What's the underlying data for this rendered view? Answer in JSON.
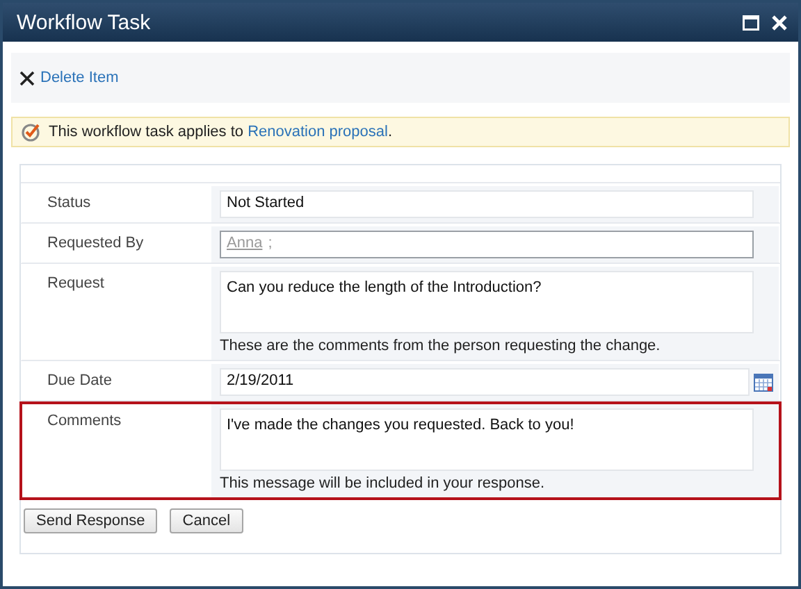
{
  "window": {
    "title": "Workflow Task"
  },
  "toolbar": {
    "delete_label": "Delete Item"
  },
  "info_bar": {
    "text": "This workflow task applies to ",
    "link": "Renovation proposal",
    "suffix": "."
  },
  "fields": [
    {
      "label": "Status",
      "kind": "text",
      "value": "Not Started",
      "highlighted": false
    },
    {
      "label": "Requested By",
      "kind": "people",
      "value": "Anna",
      "separator": ";",
      "highlighted": false
    },
    {
      "label": "Request",
      "kind": "textarea",
      "value": "Can you reduce the length of the Introduction?",
      "hint": "These are the comments from the person requesting the change.",
      "highlighted": false
    },
    {
      "label": "Due Date",
      "kind": "date",
      "value": "2/19/2011",
      "highlighted": false
    },
    {
      "label": "Comments",
      "kind": "textarea",
      "value": "I've made the changes you requested. Back to you!",
      "hint": "This message will be included in your response.",
      "highlighted": true
    }
  ],
  "buttons": [
    "Send Response",
    "Cancel"
  ]
}
